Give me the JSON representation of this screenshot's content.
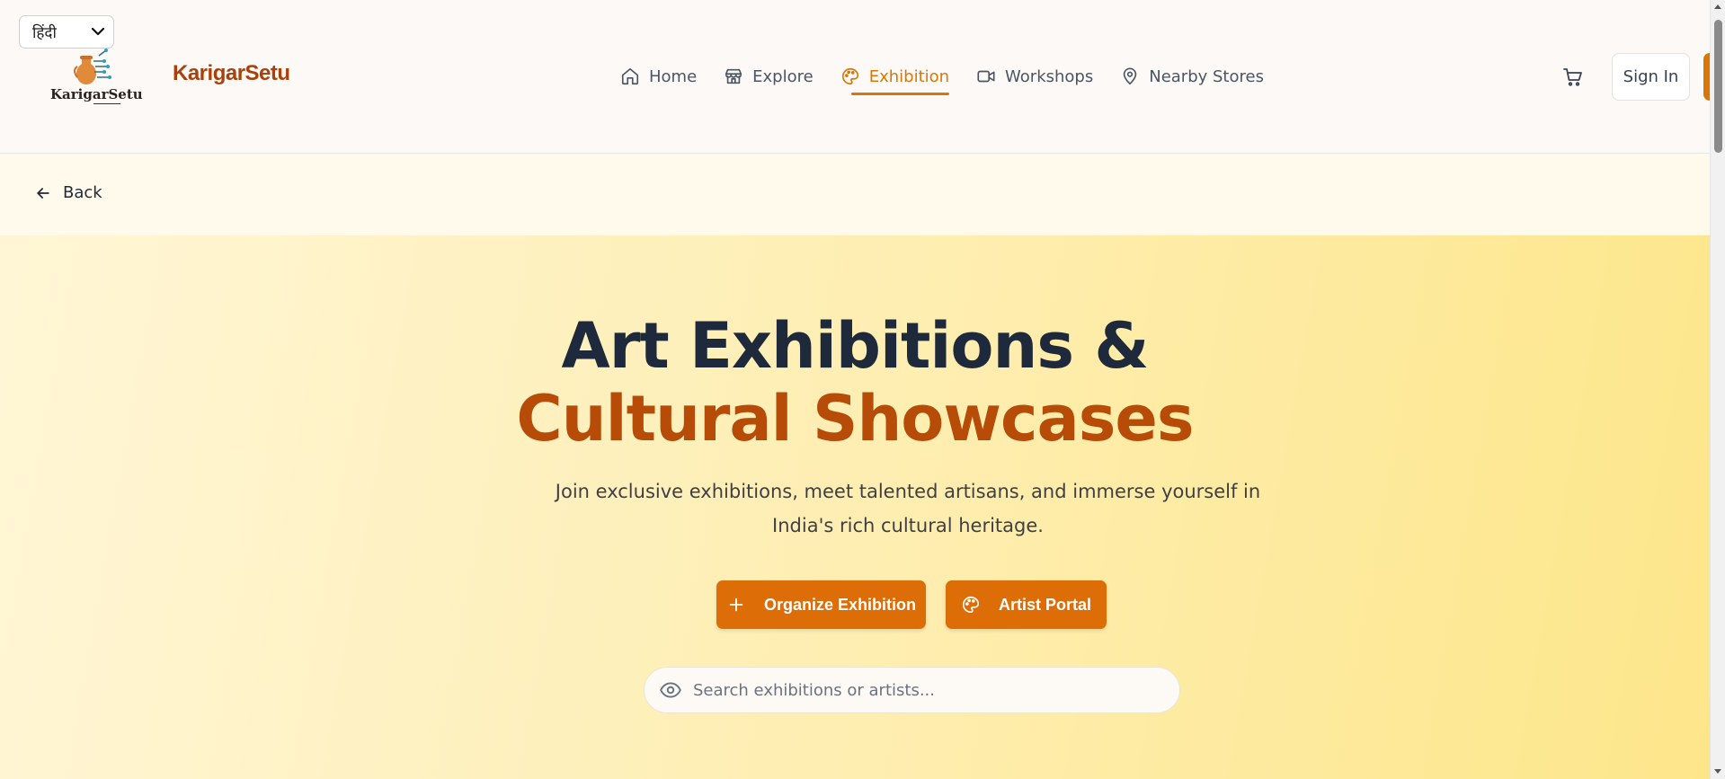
{
  "header": {
    "language_selected": "हिंदी",
    "logo_text": "KarigarSetu",
    "brand": "KarigarSetu",
    "nav": [
      {
        "label": "Home",
        "icon": "home-icon"
      },
      {
        "label": "Explore",
        "icon": "store-icon"
      },
      {
        "label": "Exhibition",
        "icon": "palette-icon",
        "active": true
      },
      {
        "label": "Workshops",
        "icon": "video-icon"
      },
      {
        "label": "Nearby Stores",
        "icon": "map-pin-icon"
      }
    ],
    "signin_label": "Sign In"
  },
  "back_label": "Back",
  "hero": {
    "title_line1": "Art Exhibitions &",
    "title_line2": "Cultural Showcases",
    "subtitle": "Join exclusive exhibitions, meet talented artisans, and immerse yourself in India's rich cultural heritage.",
    "btn_organize": "Organize Exhibition",
    "btn_artist": "Artist Portal",
    "search_placeholder": "Search exhibitions or artists..."
  },
  "colors": {
    "accent": "#d97706",
    "brand": "#a8420c",
    "heading": "#1e293b",
    "heading_accent": "#b74c09",
    "button": "#dd6e07"
  }
}
